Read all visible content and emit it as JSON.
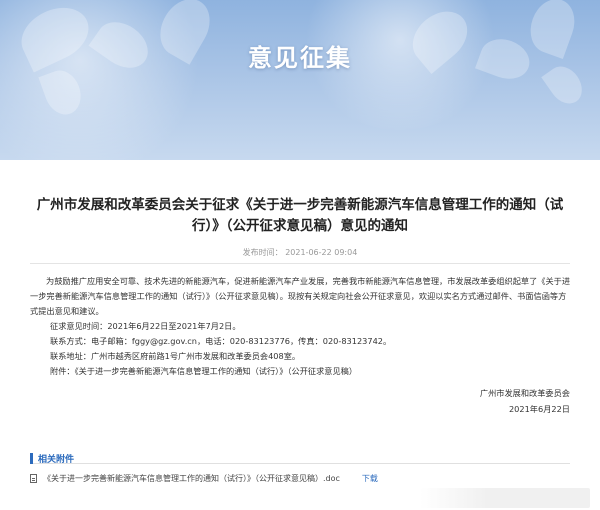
{
  "banner": {
    "title": "意见征集"
  },
  "article": {
    "title": "广州市发展和改革委员会关于征求《关于进一步完善新能源汽车信息管理工作的通知（试行）》（公开征求意见稿）意见的通知",
    "publish_time": "发布时间： 2021-06-22 09:04",
    "paragraph": "为鼓励推广应用安全可靠、技术先进的新能源汽车，促进新能源汽车产业发展，完善我市新能源汽车信息管理，市发展改革委组织起草了《关于进一步完善新能源汽车信息管理工作的通知（试行）》（公开征求意见稿）。现按有关规定向社会公开征求意见，欢迎以实名方式通过邮件、书面信函等方式提出意见和建议。",
    "period": "征求意见时间：2021年6月22日至2021年7月2日。",
    "contact": "联系方式：电子邮箱：fggy@gz.gov.cn，电话：020-83123776，传真：020-83123742。",
    "address": "联系地址：广州市越秀区府前路1号广州市发展和改革委员会408室。",
    "attachment_line": "附件：《关于进一步完善新能源汽车信息管理工作的通知（试行）》（公开征求意见稿）",
    "signature_org": "广州市发展和改革委员会",
    "signature_date": "2021年6月22日"
  },
  "attachments": {
    "header": "相关附件",
    "items": [
      {
        "name": "《关于进一步完善新能源汽车信息管理工作的通知（试行）》（公开征求意见稿）.doc",
        "action": "下载"
      }
    ]
  },
  "colors": {
    "accent": "#2c6bbd",
    "banner": "#a9c4e6"
  }
}
